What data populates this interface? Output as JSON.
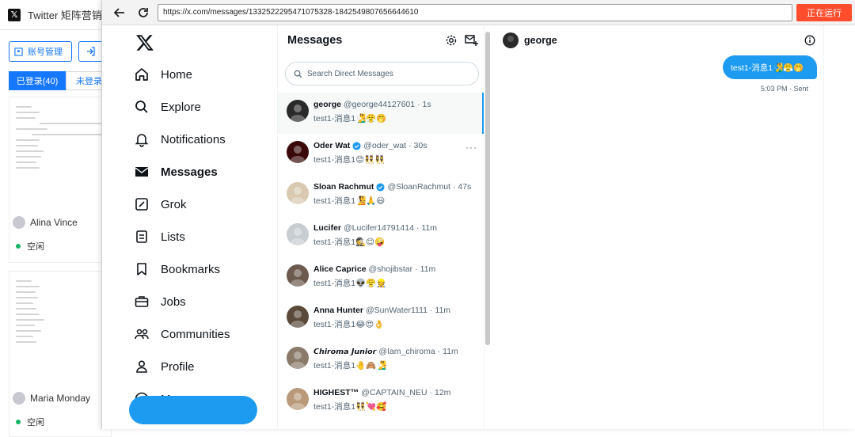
{
  "bg": {
    "title": "Twitter 矩阵营销",
    "btn_account": "账号管理",
    "tab_logged": "已登录(40)",
    "tab_unlogged": "未登录",
    "cards": [
      {
        "name": "Alina Vince",
        "status": "空闲"
      },
      {
        "name": "Maria Monday",
        "status": "空闲"
      }
    ]
  },
  "browser": {
    "url": "https://x.com/messages/1332522295471075328-1842549807656644610",
    "run_label": "正在运行"
  },
  "nav": {
    "items": [
      {
        "label": "Home",
        "icon": "home-icon"
      },
      {
        "label": "Explore",
        "icon": "search-icon"
      },
      {
        "label": "Notifications",
        "icon": "bell-icon"
      },
      {
        "label": "Messages",
        "icon": "envelope-icon"
      },
      {
        "label": "Grok",
        "icon": "grok-icon"
      },
      {
        "label": "Lists",
        "icon": "list-icon"
      },
      {
        "label": "Bookmarks",
        "icon": "bookmark-icon"
      },
      {
        "label": "Jobs",
        "icon": "briefcase-icon"
      },
      {
        "label": "Communities",
        "icon": "people-icon"
      },
      {
        "label": "Profile",
        "icon": "person-icon"
      },
      {
        "label": "More",
        "icon": "more-circle-icon"
      }
    ]
  },
  "messages": {
    "title": "Messages",
    "search_placeholder": "Search Direct Messages",
    "conversations": [
      {
        "name": "george",
        "handle": "@george44127601",
        "time": "· 1s",
        "preview": "test1-消息1🧏‍♂️😤🤭",
        "verified": false,
        "avatar_color": "#2a2a2a"
      },
      {
        "name": "Oder Wat",
        "handle": "@oder_wat",
        "time": "· 30s",
        "preview": "test1-消息1😟👯👯‍♀️",
        "verified": true,
        "avatar_color": "#3a0a0a"
      },
      {
        "name": "Sloan Rachmut",
        "handle": "@SloanRachmut",
        "time": "· 47s",
        "preview": "test1-消息1🧏🙏😃",
        "verified": true,
        "avatar_color": "#d8c9b0"
      },
      {
        "name": "Lucifer",
        "handle": "@Lucifer14791414",
        "time": "· 11m",
        "preview": "test1-消息1🕵️😊🤪",
        "verified": false,
        "avatar_color": "#c8cdd2"
      },
      {
        "name": "Alice Caprice",
        "handle": "@shojibstar",
        "time": "· 11m",
        "preview": "test1-消息1👽😤👷",
        "verified": false,
        "avatar_color": "#6b5a4d"
      },
      {
        "name": "Anna Hunter",
        "handle": "@SunWater1111",
        "time": "· 11m",
        "preview": "test1-消息1😂😍👌",
        "verified": false,
        "avatar_color": "#5a4a3a"
      },
      {
        "name": "𝘾𝙝𝙞𝙧𝙤𝙢𝙖 𝙅𝙪𝙣𝙞𝙤𝙧",
        "handle": "@Iam_chiroma",
        "time": "· 11m",
        "preview": "test1-消息1🤚🙈🧏‍♂️",
        "verified": false,
        "avatar_color": "#8a7a6a"
      },
      {
        "name": "HIGHEST™",
        "handle": "@CAPTAIN_NEU",
        "time": "· 12m",
        "preview": "test1-消息1👯💘🥰",
        "verified": false,
        "avatar_color": "#b89a7a"
      }
    ]
  },
  "chat": {
    "name": "george",
    "bubble": "test1-消息1🧏‍♂️😤🤭",
    "meta": "5:03 PM · Sent"
  }
}
